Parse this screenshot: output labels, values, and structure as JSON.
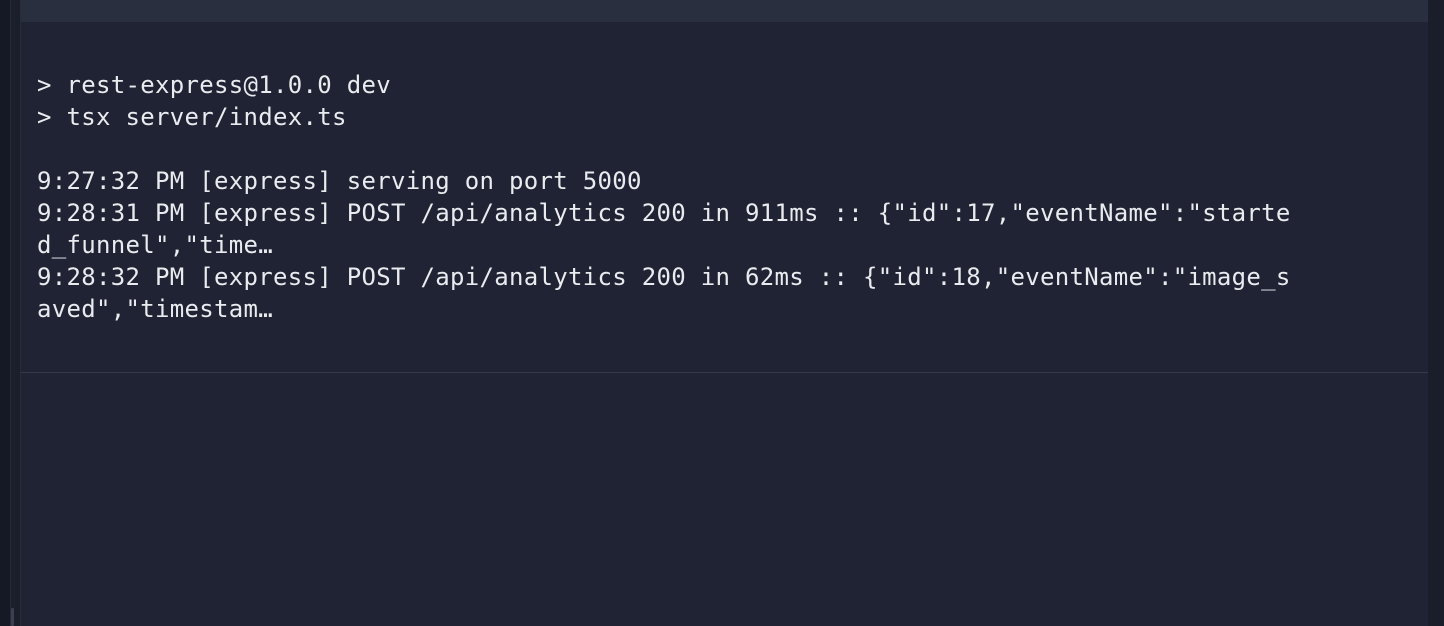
{
  "console": {
    "lines": [
      "> rest-express@1.0.0 dev",
      "> tsx server/index.ts",
      "",
      "9:27:32 PM [express] serving on port 5000",
      "9:28:31 PM [express] POST /api/analytics 200 in 911ms :: {\"id\":17,\"eventName\":\"starte",
      "d_funnel\",\"time…",
      "9:28:32 PM [express] POST /api/analytics 200 in 62ms :: {\"id\":18,\"eventName\":\"image_s",
      "aved\",\"timestam…"
    ]
  },
  "colors": {
    "background": "#1f2333",
    "text": "#e9ebef",
    "top_bar": "#2a2f3f",
    "divider": "#353a4a"
  }
}
